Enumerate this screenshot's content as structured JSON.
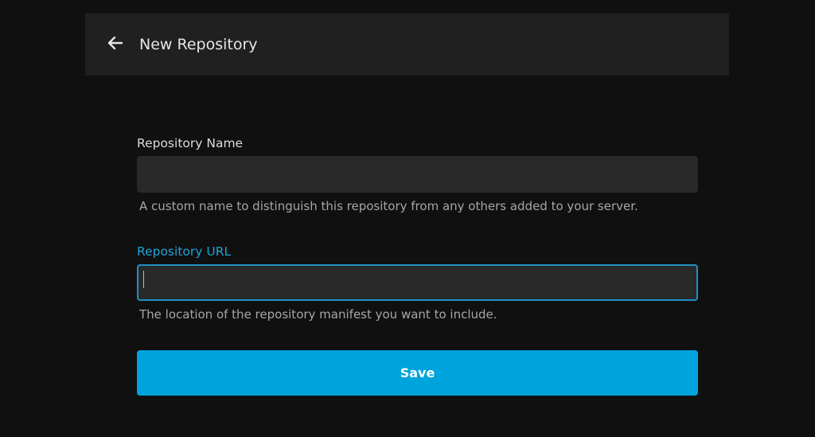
{
  "header": {
    "back_icon": "arrow-left-icon",
    "title": "New Repository"
  },
  "form": {
    "name_field": {
      "label": "Repository Name",
      "value": "",
      "help": "A custom name to distinguish this repository from any others added to your server."
    },
    "url_field": {
      "label": "Repository URL",
      "value": "",
      "help": "The location of the repository manifest you want to include."
    },
    "save_label": "Save"
  },
  "colors": {
    "background": "#101010",
    "header_bg": "#202020",
    "input_bg": "#292929",
    "accent": "#00a4dc",
    "focus_label": "#1fa3d9"
  }
}
